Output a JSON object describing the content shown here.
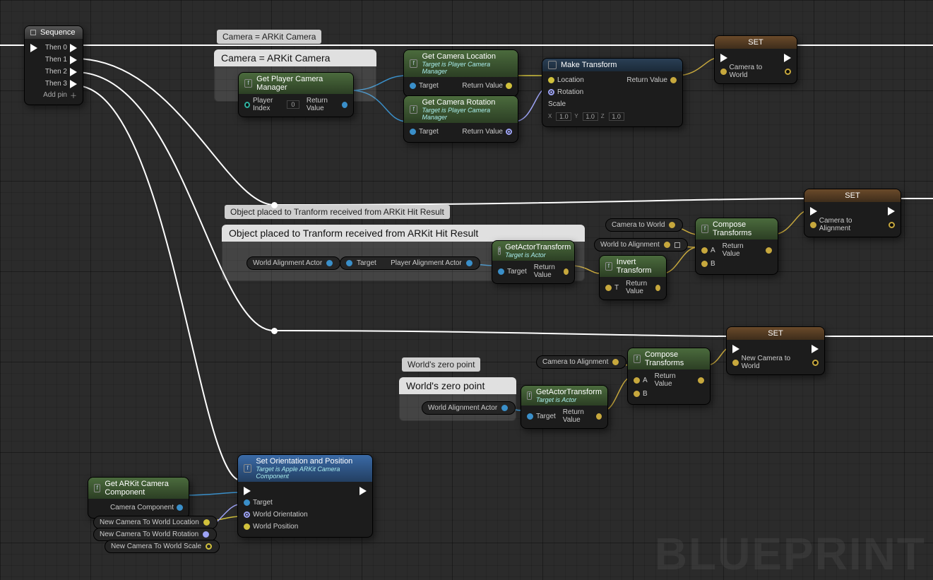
{
  "watermark": "BLUEPRINT",
  "sequence": {
    "title": "Sequence",
    "pins": [
      "Then 0",
      "Then 1",
      "Then 2",
      "Then 3"
    ],
    "addpin": "Add pin"
  },
  "comment1": {
    "hint": "Camera = ARKit Camera",
    "title": "Camera = ARKit Camera"
  },
  "comment2": {
    "hint": "Object placed to Tranform received from ARKit Hit Result",
    "title": "Object placed to Tranform received from ARKit Hit Result"
  },
  "comment3": {
    "hint": "World's zero point",
    "title": "World's zero point"
  },
  "getPlayerCamMgr": {
    "title": "Get Player Camera Manager",
    "playerIndex": "Player Index",
    "playerIndexVal": "0",
    "returnValue": "Return Value"
  },
  "getCamLoc": {
    "title": "Get Camera Location",
    "sub": "Target is Player Camera Manager",
    "target": "Target",
    "returnValue": "Return Value"
  },
  "getCamRot": {
    "title": "Get Camera Rotation",
    "sub": "Target is Player Camera Manager",
    "target": "Target",
    "returnValue": "Return Value"
  },
  "makeTransform": {
    "title": "Make Transform",
    "location": "Location",
    "rotation": "Rotation",
    "scale": "Scale",
    "x": "X",
    "y": "Y",
    "z": "Z",
    "val": "1.0",
    "returnValue": "Return Value"
  },
  "set1": {
    "title": "SET",
    "var": "Camera to World"
  },
  "var_worldAlignActor": "World Alignment Actor",
  "var_targetPill": "Target",
  "var_playerAlignActor": "Player Alignment Actor",
  "getActorTransform1": {
    "title": "GetActorTransform",
    "sub": "Target is Actor",
    "target": "Target",
    "returnValue": "Return Value"
  },
  "var_camToWorld": "Camera to World",
  "var_worldToAlign": "World to Alignment",
  "invertTransform": {
    "title": "Invert Transform",
    "t": "T",
    "returnValue": "Return Value"
  },
  "compose1": {
    "title": "Compose Transforms",
    "a": "A",
    "b": "B",
    "returnValue": "Return Value"
  },
  "set2": {
    "title": "SET",
    "var": "Camera to Alignment"
  },
  "var_camToAlign": "Camera to Alignment",
  "getActorTransform2": {
    "title": "GetActorTransform",
    "sub": "Target is Actor",
    "target": "Target",
    "returnValue": "Return Value"
  },
  "var_worldAlignActor2": "World Alignment Actor",
  "compose2": {
    "title": "Compose Transforms",
    "a": "A",
    "b": "B",
    "returnValue": "Return Value"
  },
  "set3": {
    "title": "SET",
    "var": "New Camera to World"
  },
  "setOrientPos": {
    "title": "Set Orientation and Position",
    "sub": "Target is Apple ARKit Camera Component",
    "target": "Target",
    "worldOrient": "World Orientation",
    "worldPos": "World Position"
  },
  "getARKitCam": {
    "title": "Get ARKit Camera Component",
    "cameraComponent": "Camera Component"
  },
  "newCamLoc": "New Camera To World Location",
  "newCamRot": "New Camera To World Rotation",
  "newCamScale": "New Camera To World Scale"
}
